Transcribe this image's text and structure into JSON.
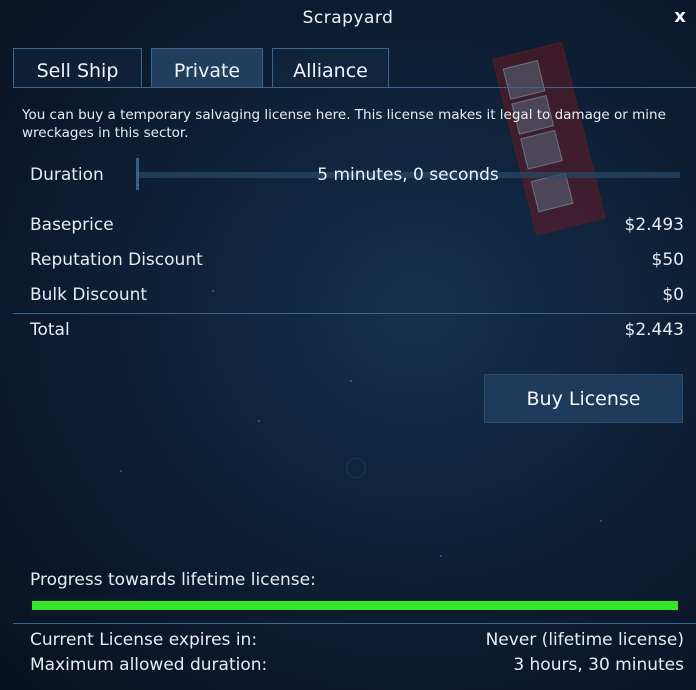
{
  "window": {
    "title": "Scrapyard",
    "close_glyph": "x"
  },
  "tabs": [
    {
      "label": "Sell Ship",
      "active": false
    },
    {
      "label": "Private",
      "active": true
    },
    {
      "label": "Alliance",
      "active": false
    }
  ],
  "description": "You can buy a temporary salvaging license here. This license makes it legal to damage or mine wreckages in this sector.",
  "duration": {
    "label": "Duration",
    "value": "5 minutes, 0 seconds",
    "slider_fraction": 0.0
  },
  "pricing": {
    "baseprice": {
      "label": "Baseprice",
      "value": "$2.493"
    },
    "reputation_discount": {
      "label": "Reputation Discount",
      "value": "$50"
    },
    "bulk_discount": {
      "label": "Bulk Discount",
      "value": "$0"
    },
    "total": {
      "label": "Total",
      "value": "$2.443"
    }
  },
  "buy_button": {
    "label": "Buy License"
  },
  "progress": {
    "label": "Progress towards lifetime license:",
    "fraction": 1.0,
    "color": "#35e62a"
  },
  "license_info": {
    "expires": {
      "label": "Current License expires in:",
      "value": "Never (lifetime license)"
    },
    "max_duration": {
      "label": "Maximum allowed duration:",
      "value": "3 hours, 30 minutes"
    }
  },
  "colors": {
    "panel_border": "#3b6690",
    "button_bg": "#1d3a5a",
    "progress_green": "#35e62a"
  }
}
